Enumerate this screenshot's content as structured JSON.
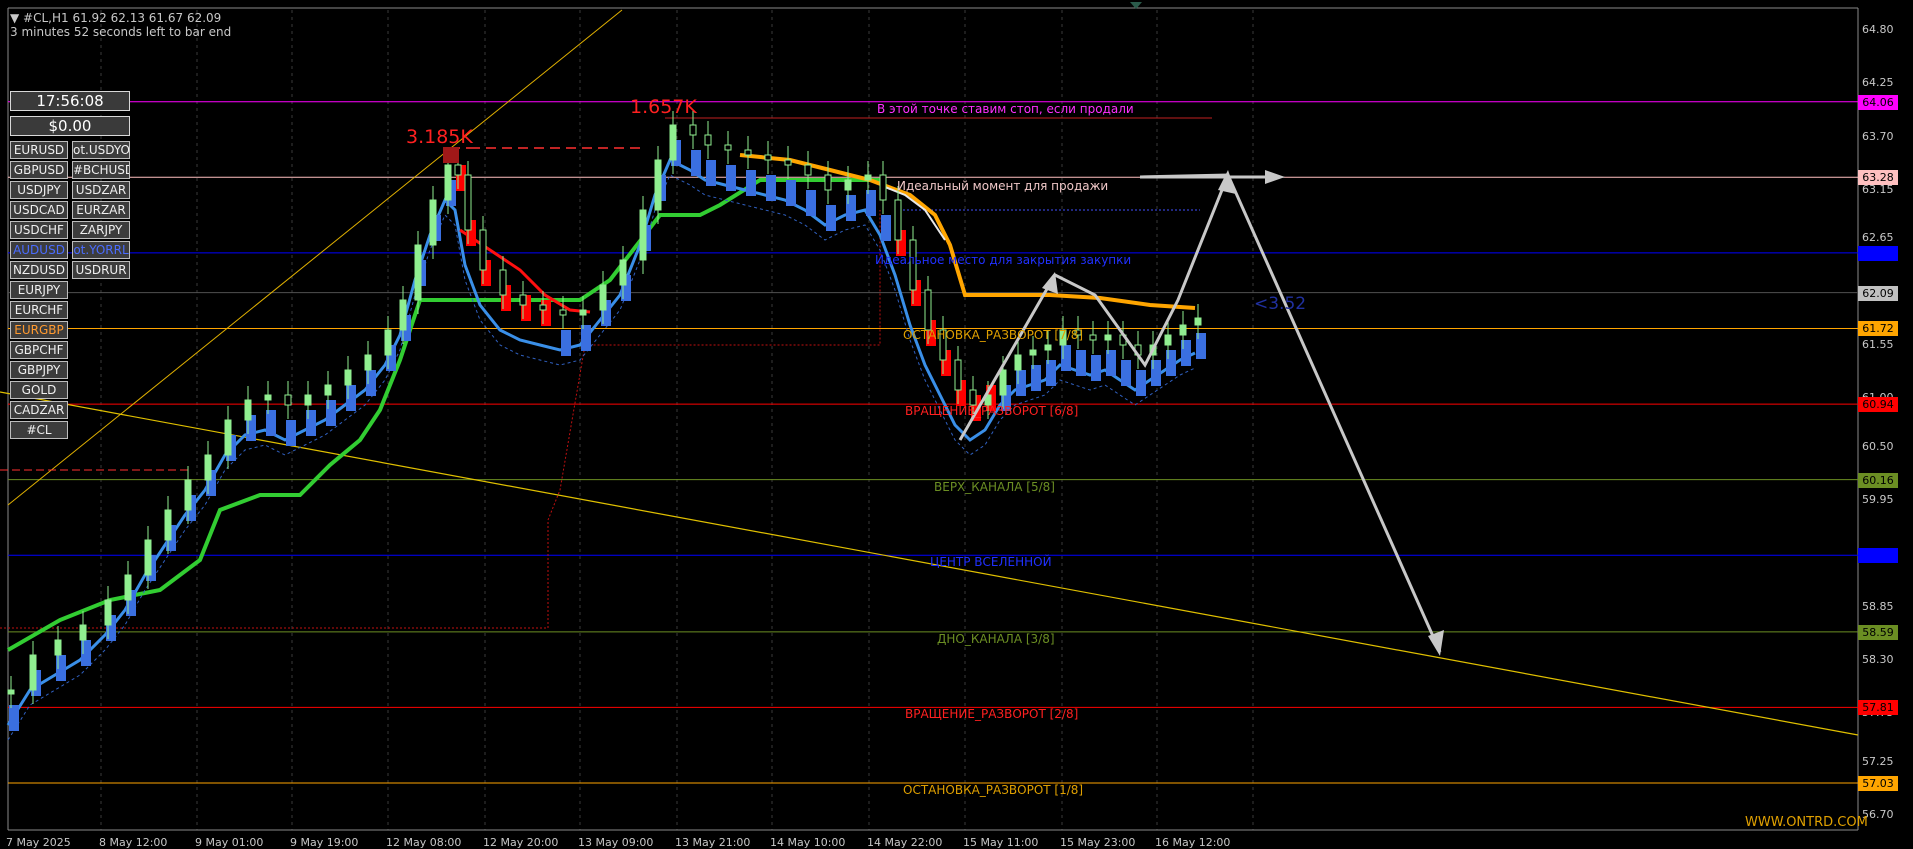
{
  "header": {
    "symbol_line": "▼ #CL,H1  61.92 62.13 61.67 62.09",
    "timer_line": "3 minutes 52 seconds left to bar end"
  },
  "panel": {
    "clock": "17:56:08",
    "balance": "$0.00",
    "symbols_col1": [
      "EURUSD",
      "GBPUSD",
      "USDJPY",
      "USDCAD",
      "USDCHF",
      "AUDUSD",
      "NZDUSD",
      "EURJPY",
      "EURCHF",
      "EURGBP",
      "GBPCHF",
      "GBPJPY",
      "GOLD",
      "CADZAR",
      "#CL"
    ],
    "symbols_col2": [
      "ot.USDYO",
      "#BCHUSD",
      "USDZAR",
      "EURZAR",
      "ZARJPY",
      "ot.YORRL",
      "USDRUR"
    ]
  },
  "price_axis": [
    "64.80",
    "64.25",
    "63.70",
    "63.15",
    "62.65",
    "62.10",
    "61.55",
    "61.00",
    "60.50",
    "59.95",
    "59.40",
    "58.85",
    "58.30",
    "57.75",
    "57.25",
    "56.70"
  ],
  "price_tags": [
    {
      "value": "64.06",
      "bg": "#ff00ff",
      "fg": "#000000"
    },
    {
      "value": "63.28",
      "bg": "#ffc0c0",
      "fg": "#000000"
    },
    {
      "value": "62.50",
      "bg": "#0000ff",
      "fg": "#0000ff"
    },
    {
      "value": "62.09",
      "bg": "#c0c0c0",
      "fg": "#000000"
    },
    {
      "value": "61.72",
      "bg": "#ffa500",
      "fg": "#000000"
    },
    {
      "value": "60.94",
      "bg": "#ff0000",
      "fg": "#000000"
    },
    {
      "value": "60.16",
      "bg": "#6b8e23",
      "fg": "#000000"
    },
    {
      "value": "59.38",
      "bg": "#0000ff",
      "fg": "#0000ff"
    },
    {
      "value": "58.59",
      "bg": "#6b8e23",
      "fg": "#000000"
    },
    {
      "value": "57.81",
      "bg": "#ff0000",
      "fg": "#000000"
    },
    {
      "value": "57.03",
      "bg": "#ffa500",
      "fg": "#000000"
    }
  ],
  "time_axis": [
    "7 May 2025",
    "8 May 12:00",
    "9 May 01:00",
    "9 May 19:00",
    "12 May 08:00",
    "12 May 20:00",
    "13 May 09:00",
    "13 May 21:00",
    "14 May 10:00",
    "14 May 22:00",
    "15 May 11:00",
    "15 May 23:00",
    "16 May 12:00"
  ],
  "levels": {
    "stop_note": "В этой точке ставим стоп, если продали",
    "ideal_sell": "Идеальный момент для продажи",
    "close_buy": "Идеальное место для закрытия закупки",
    "stop_7_8": "ОСТАНОВКА_РАЗВОРОТ [7/8]",
    "rot_6_8": "ВРАЩЕНИЕ_РАЗВОРОТ [6/8]",
    "top_5_8": "ВЕРХ_КАНАЛА [5/8]",
    "center": "ЦЕНТР ВСЕЛЕННОЙ",
    "bottom_3_8": "ДНО_КАНАЛА [3/8]",
    "rot_2_8": "ВРАЩЕНИЕ_РАЗВОРОТ [2/8]",
    "stop_1_8": "ОСТАНОВКА_РАЗВОРОТ [1/8]"
  },
  "annotations": {
    "peak1": "3.185K",
    "peak2": "1.657K",
    "delta": "<3.52",
    "watermark": "WWW.ONTRD.COM"
  },
  "colors": {
    "bull": "#90ee90",
    "bear_fill": "#000000",
    "kumo_blue": "#3a6fe0",
    "kumo_red": "#ff0000",
    "green_line": "#32cd32",
    "orange_line": "#ffa500",
    "arrow": "#c8c8c8"
  }
}
